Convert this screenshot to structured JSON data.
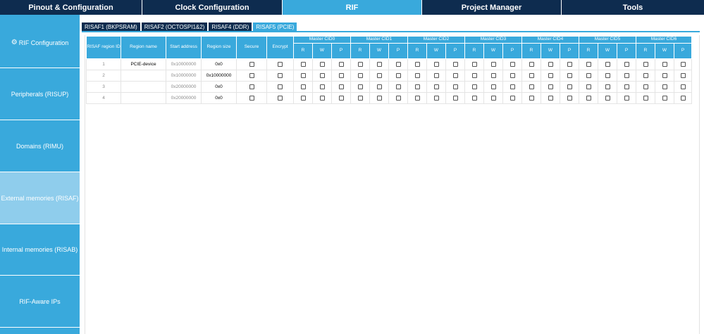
{
  "top_nav": {
    "tabs": [
      "Pinout & Configuration",
      "Clock Configuration",
      "RIF",
      "Project Manager",
      "Tools"
    ],
    "active": "RIF"
  },
  "side_nav": {
    "items": [
      "RIF Configuration",
      "Peripherals (RISUP)",
      "Domains (RIMU)",
      "External memories (RISAF)",
      "Internal memories (RISAB)",
      "RIF-Aware IPs"
    ],
    "selected": "External memories (RISAF)"
  },
  "sub_tabs": {
    "items": [
      "RISAF1 (BKPSRAM)",
      "RISAF2 (OCTOSPI1&2)",
      "RISAF4 (DDR)",
      "RISAF5 (PCIE)"
    ],
    "active": "RISAF5 (PCIE)"
  },
  "table": {
    "headers": {
      "id": "RISAF region ID",
      "name": "Region name",
      "start": "Start address",
      "size": "Region size",
      "secure": "Secure",
      "encrypt": "Encrypt"
    },
    "master_cids": [
      "Master CID0",
      "Master CID1",
      "Master CID2",
      "Master CID3",
      "Master CID4",
      "Master CID5",
      "Master CID6"
    ],
    "perm_labels": [
      "R",
      "W",
      "P"
    ],
    "rows": [
      {
        "id": "1",
        "name": "PCIE-device",
        "start": "0x10000000",
        "size": "0x0"
      },
      {
        "id": "2",
        "name": "",
        "start": "0x10000000",
        "size": "0x10000000"
      },
      {
        "id": "3",
        "name": "",
        "start": "0x20000000",
        "size": "0x0"
      },
      {
        "id": "4",
        "name": "",
        "start": "0x20000000",
        "size": "0x0"
      }
    ]
  },
  "colors": {
    "nav_dark": "#0e2c4f",
    "accent": "#39a9dc",
    "selected": "#8fcdec"
  }
}
